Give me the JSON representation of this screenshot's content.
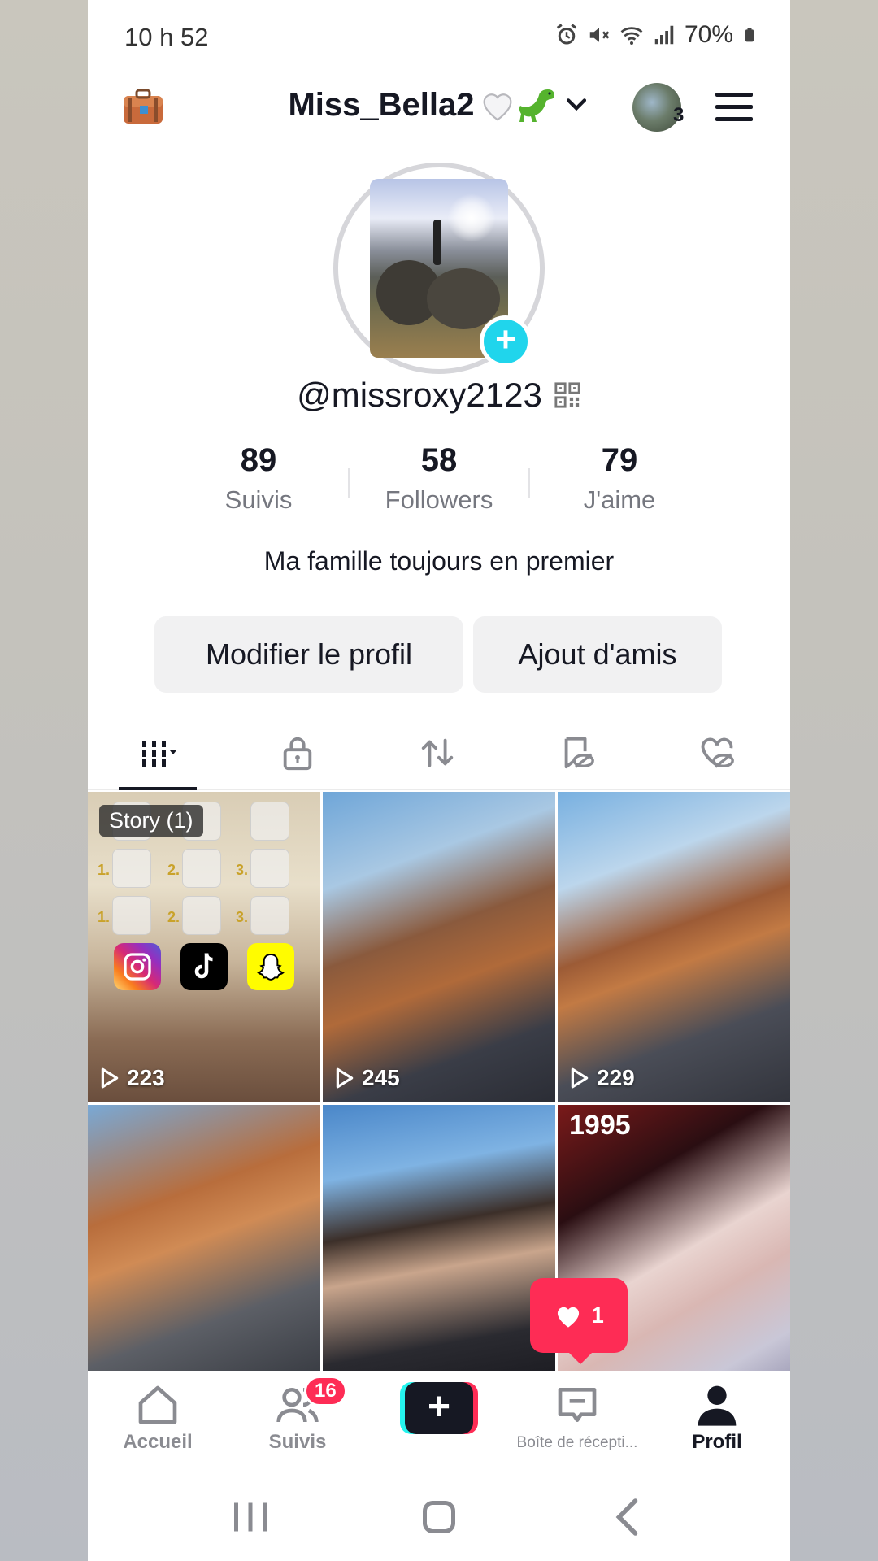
{
  "status_bar": {
    "time": "10 h 52",
    "battery": "70%"
  },
  "header": {
    "account_name": "Miss_Bella2",
    "emoji": "🤍🦕",
    "avatar_count": "3"
  },
  "profile": {
    "username": "@missroxy2123",
    "stats": [
      {
        "value": "89",
        "label": "Suivis"
      },
      {
        "value": "58",
        "label": "Followers"
      },
      {
        "value": "79",
        "label": "J'aime"
      }
    ],
    "bio": "Ma famille toujours en premier",
    "edit_button": "Modifier le profil",
    "add_friends_button": "Ajout d'amis"
  },
  "tabs": [
    "videos-grid",
    "private-lock",
    "reposts",
    "favorites-hidden",
    "liked-hidden"
  ],
  "videos": [
    {
      "badge": "Story (1)",
      "views": "223"
    },
    {
      "views": "245"
    },
    {
      "views": "229"
    },
    {},
    {},
    {
      "overlay_text": "1995"
    }
  ],
  "likes_popup": {
    "count": "1"
  },
  "bottom_nav": {
    "home": "Accueil",
    "following": "Suivis",
    "following_badge": "16",
    "inbox": "Boîte de récepti...",
    "profile": "Profil"
  },
  "colors": {
    "accent": "#fe2c55",
    "cyan": "#20d5ec",
    "text": "#161823",
    "muted": "#75777f"
  }
}
